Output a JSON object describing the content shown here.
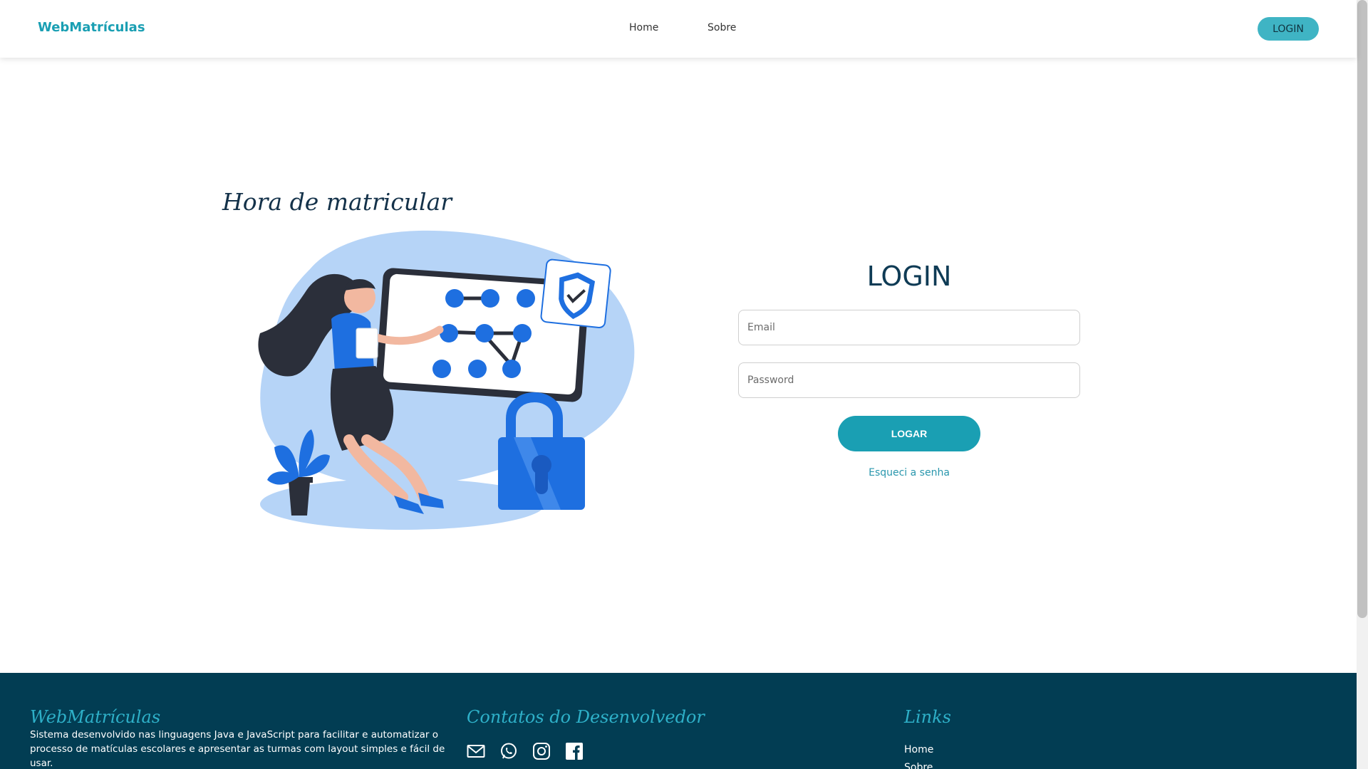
{
  "navbar": {
    "brand": "WebMatrículas",
    "links": [
      "Home",
      "Sobre"
    ],
    "login_button": "LOGIN"
  },
  "hero": {
    "title": "Hora de matricular",
    "illustration": "login-security-illustration"
  },
  "login_form": {
    "title": "LOGIN",
    "email_placeholder": "Email",
    "password_placeholder": "Password",
    "submit_label": "LOGAR",
    "forgot_link": "Esqueci a senha"
  },
  "footer": {
    "about_title": "WebMatrículas",
    "about_text": "Sistema desenvolvido nas linguagens Java e JavaScript para facilitar e automatizar o processo de matículas escolares e apresentar as turmas com layout simples e fácil de usar.",
    "contacts_title": "Contatos do Desenvolvedor",
    "contact_icons": [
      "mail-icon",
      "whatsapp-icon",
      "instagram-icon",
      "facebook-icon"
    ],
    "links_title": "Links",
    "links": [
      "Home",
      "Sobre"
    ]
  },
  "colors": {
    "accent": "#1a9fb3",
    "footer_bg": "#023d53",
    "dark_text": "#0f3b55"
  }
}
